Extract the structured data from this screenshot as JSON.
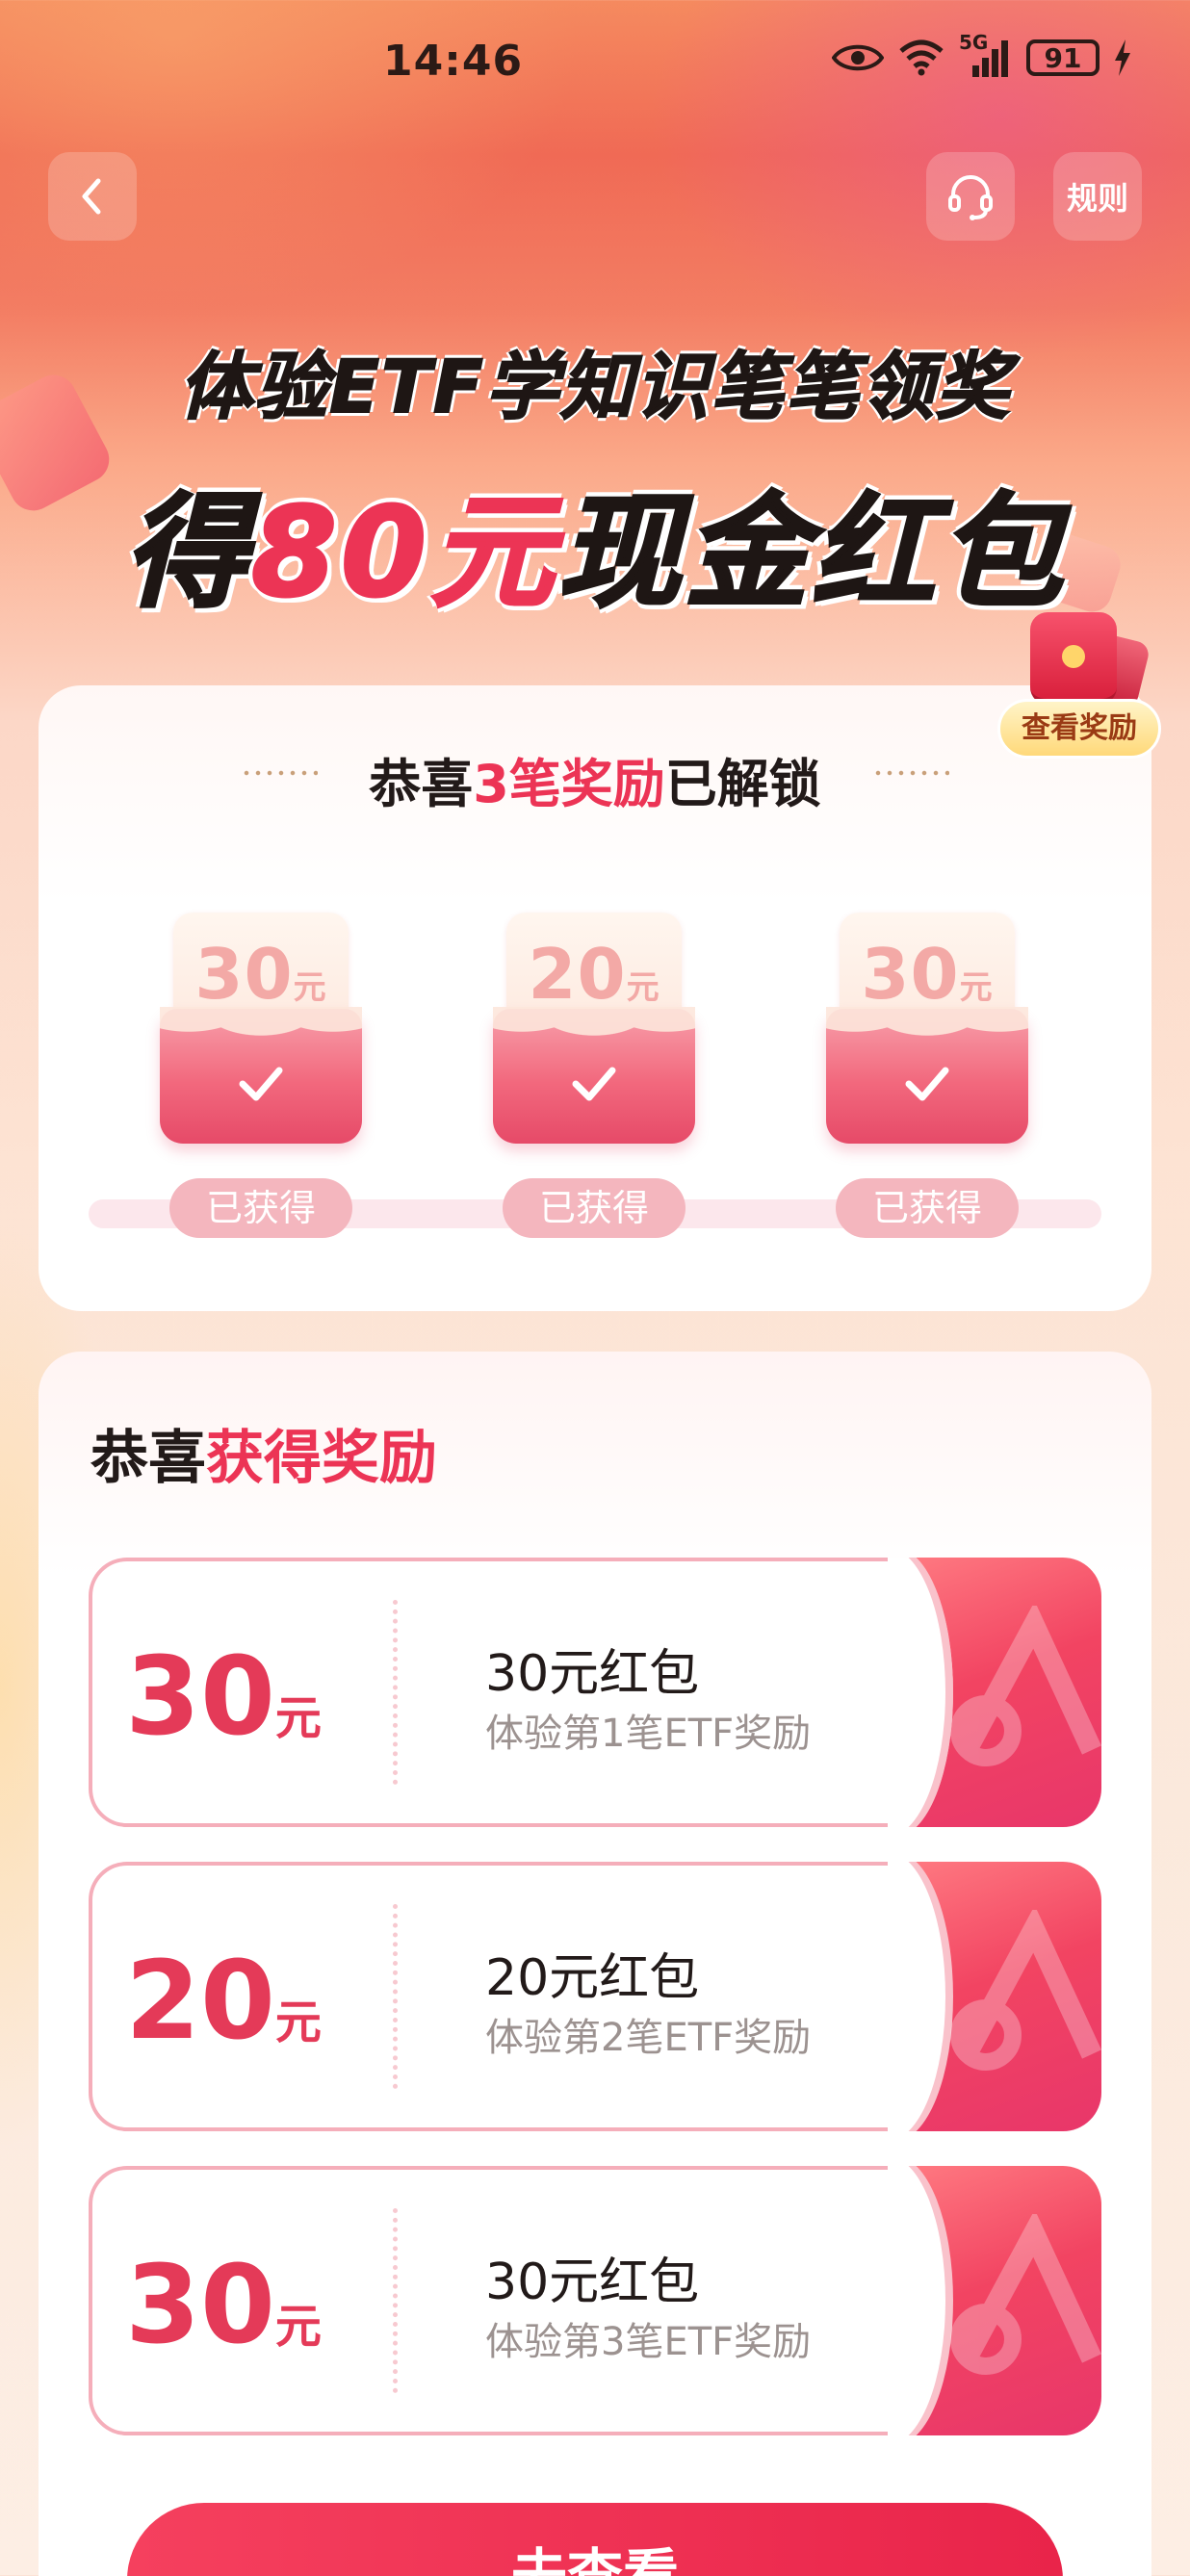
{
  "status_bar": {
    "time": "14:46",
    "network": "5G",
    "battery": "91",
    "icons": [
      "eye-icon",
      "wifi-icon",
      "signal-icon",
      "battery-icon",
      "charging-icon"
    ]
  },
  "nav": {
    "back_icon": "chevron-left-icon",
    "service_icon": "headset-icon",
    "rules_label": "规则"
  },
  "hero": {
    "line1": "体验ETF学知识笔笔领奖",
    "line2_prefix": "得",
    "line2_amount": "80元",
    "line2_suffix": "现金红包"
  },
  "view_reward_label": "查看奖励",
  "unlock": {
    "title_prefix": "恭喜",
    "title_highlight": "3笔奖励",
    "title_suffix": "已解锁",
    "coupons": [
      {
        "value": "30",
        "unit": "元",
        "status": "已获得"
      },
      {
        "value": "20",
        "unit": "元",
        "status": "已获得"
      },
      {
        "value": "30",
        "unit": "元",
        "status": "已获得"
      }
    ]
  },
  "rewards": {
    "title_prefix": "恭喜",
    "title_highlight": "获得奖励",
    "items": [
      {
        "amount": "30",
        "unit": "元",
        "name": "30元红包",
        "desc": "体验第1笔ETF奖励"
      },
      {
        "amount": "20",
        "unit": "元",
        "name": "20元红包",
        "desc": "体验第2笔ETF奖励"
      },
      {
        "amount": "30",
        "unit": "元",
        "name": "30元红包",
        "desc": "体验第3笔ETF奖励"
      }
    ]
  },
  "cta_label": "去查看",
  "colors": {
    "accent": "#ec3455",
    "text": "#221a19",
    "muted": "#9c9290"
  }
}
